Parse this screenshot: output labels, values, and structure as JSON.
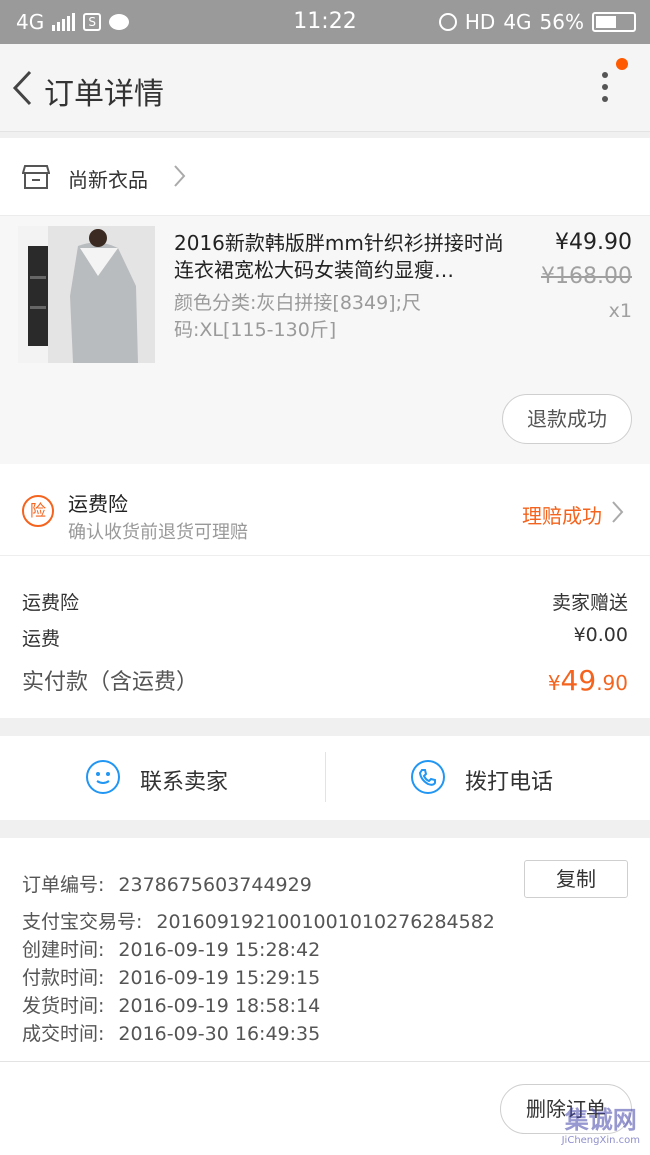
{
  "status_bar": {
    "network": "4G",
    "time": "11:22",
    "hd": "HD",
    "network_right": "4G",
    "battery": "56%",
    "battery_level": 0.56
  },
  "nav": {
    "title": "订单详情"
  },
  "shop": {
    "name": "尚新衣品"
  },
  "product": {
    "title": "2016新款韩版胖mm针织衫拼接时尚连衣裙宽松大码女装简约显瘦…",
    "sku": "颜色分类:灰白拼接[8349];尺码:XL[115-130斤]",
    "price": "¥49.90",
    "original_price": "¥168.00",
    "quantity": "x1",
    "refund_status": "退款成功"
  },
  "insurance": {
    "badge": "险",
    "title": "运费险",
    "subtitle": "确认收货前退货可理赔",
    "status": "理赔成功"
  },
  "fees": {
    "insurance_label": "运费险",
    "insurance_value": "卖家赠送",
    "shipping_label": "运费",
    "shipping_value": "¥0.00",
    "total_label": "实付款（含运费）",
    "total_currency": "¥",
    "total_int": "49",
    "total_dec": ".90"
  },
  "contact": {
    "seller": "联系卖家",
    "phone": "拨打电话"
  },
  "order_info": {
    "order_no_label": "订单编号:",
    "order_no": "2378675603744929",
    "copy": "复制",
    "alipay_label": "支付宝交易号:",
    "alipay_no": "2016091921001001010276284582",
    "created_label": "创建时间:",
    "created": "2016-09-19 15:28:42",
    "paid_label": "付款时间:",
    "paid": "2016-09-19 15:29:15",
    "shipped_label": "发货时间:",
    "shipped": "2016-09-19 18:58:14",
    "closed_label": "成交时间:",
    "closed": "2016-09-30 16:49:35"
  },
  "bottom": {
    "delete": "删除订单"
  },
  "watermark": {
    "cn": "集诚网",
    "en": "JiChengXin.com"
  },
  "colors": {
    "accent": "#f5641e",
    "blue": "#2196f3"
  }
}
